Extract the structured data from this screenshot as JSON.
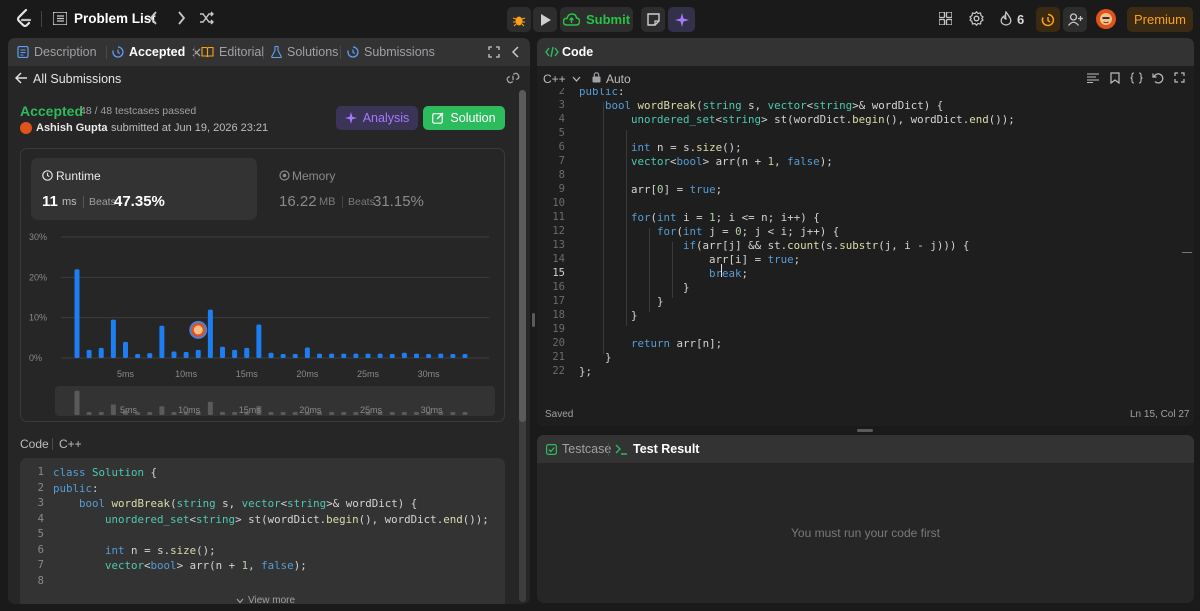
{
  "topbar": {
    "problem_list": "Problem List",
    "submit": "Submit",
    "streak": "6",
    "premium": "Premium"
  },
  "left": {
    "tabs": {
      "description": "Description",
      "accepted": "Accepted",
      "editorial": "Editorial",
      "solutions": "Solutions",
      "submissions": "Submissions"
    },
    "all_submissions": "All Submissions",
    "status": "Accepted",
    "testcases": "48 / 48 testcases passed",
    "user": "Ashish Gupta",
    "submitted_at": "submitted at Jun 19, 2026 23:21",
    "analysis": "Analysis",
    "solution": "Solution",
    "runtime": {
      "label": "Runtime",
      "value": "11",
      "unit": "ms",
      "beats_label": "Beats",
      "beats": "47.35%"
    },
    "memory": {
      "label": "Memory",
      "value": "16.22",
      "unit": "MB",
      "beats_label": "Beats",
      "beats": "31.15%"
    },
    "code_label": "Code",
    "lang_label": "C++",
    "view_more": "View more",
    "code_lines": [
      "class Solution {",
      "public:",
      "    bool wordBreak(string s, vector<string>& wordDict) {",
      "        unordered_set<string> st(wordDict.begin(), wordDict.end());",
      "",
      "        int n = s.size();",
      "        vector<bool> arr(n + 1, false);",
      ""
    ]
  },
  "editor": {
    "title": "Code",
    "language": "C++",
    "mode": "Auto",
    "saved": "Saved",
    "cursor": "Ln 15, Col 27",
    "first_line": 2,
    "lines": [
      "public:",
      "    bool wordBreak(string s, vector<string>& wordDict) {",
      "        unordered_set<string> st(wordDict.begin(), wordDict.end());",
      "",
      "        int n = s.size();",
      "        vector<bool> arr(n + 1, false);",
      "",
      "        arr[0] = true;",
      "",
      "        for(int i = 1; i <= n; i++) {",
      "            for(int j = 0; j < i; j++) {",
      "                if(arr[j] && st.count(s.substr(j, i - j))) {",
      "                    arr[i] = true;",
      "                    break;",
      "                }",
      "            }",
      "        }",
      "",
      "        return arr[n];",
      "    }",
      "};"
    ]
  },
  "bottom": {
    "testcase": "Testcase",
    "test_result": "Test Result",
    "empty_message": "You must run your code first"
  },
  "chart_data": {
    "type": "bar",
    "title": "",
    "ylabel": "",
    "xlabel": "",
    "ylim": [
      0,
      30
    ],
    "y_ticks": [
      "0%",
      "10%",
      "20%",
      "30%"
    ],
    "x_ticks": [
      "5ms",
      "10ms",
      "15ms",
      "20ms",
      "25ms",
      "30ms"
    ],
    "x_tick_positions_ms": [
      5,
      10,
      15,
      20,
      25,
      30
    ],
    "x": [
      1,
      2,
      3,
      4,
      5,
      6,
      7,
      8,
      9,
      10,
      11,
      12,
      13,
      14,
      15,
      16,
      17,
      18,
      19,
      20,
      21,
      22,
      23,
      24,
      25,
      26,
      27,
      28,
      29,
      30,
      31,
      32,
      33
    ],
    "values": [
      22,
      2,
      2.5,
      9.5,
      4,
      1,
      1.2,
      8,
      1.6,
      1.5,
      2,
      12,
      2.8,
      2,
      2.5,
      8.3,
      1.3,
      1,
      1,
      2.6,
      1.1,
      1.1,
      1.1,
      1.1,
      1.1,
      1.1,
      1,
      1.3,
      1.1,
      1,
      1.1,
      1,
      1
    ],
    "highlight_ms": 11,
    "overview_ticks": [
      "5ms",
      "10ms",
      "15ms",
      "20ms",
      "25ms",
      "30ms"
    ]
  }
}
